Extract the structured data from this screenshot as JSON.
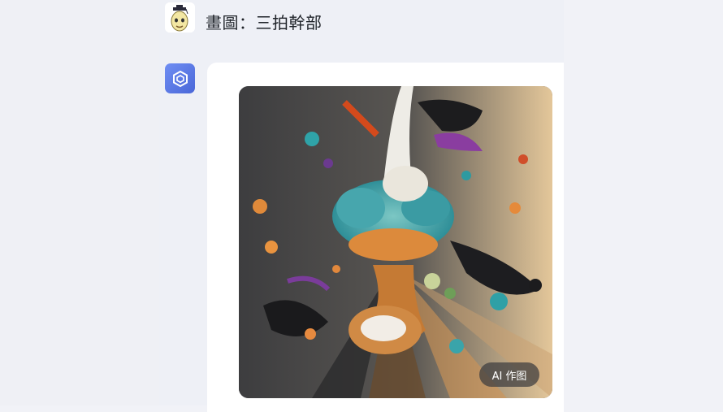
{
  "conversation": {
    "user_message": "畫圖：三拍幹部",
    "ai_badge": "AI 作图"
  },
  "colors": {
    "background": "#f1f2f7",
    "bubble": "#ffffff",
    "bot_avatar": "#5a79e6",
    "badge_bg": "#3c3c3e"
  },
  "icons": {
    "user_avatar": "cartoon-character-avatar-icon",
    "bot_avatar": "hexagon-logo-icon"
  }
}
